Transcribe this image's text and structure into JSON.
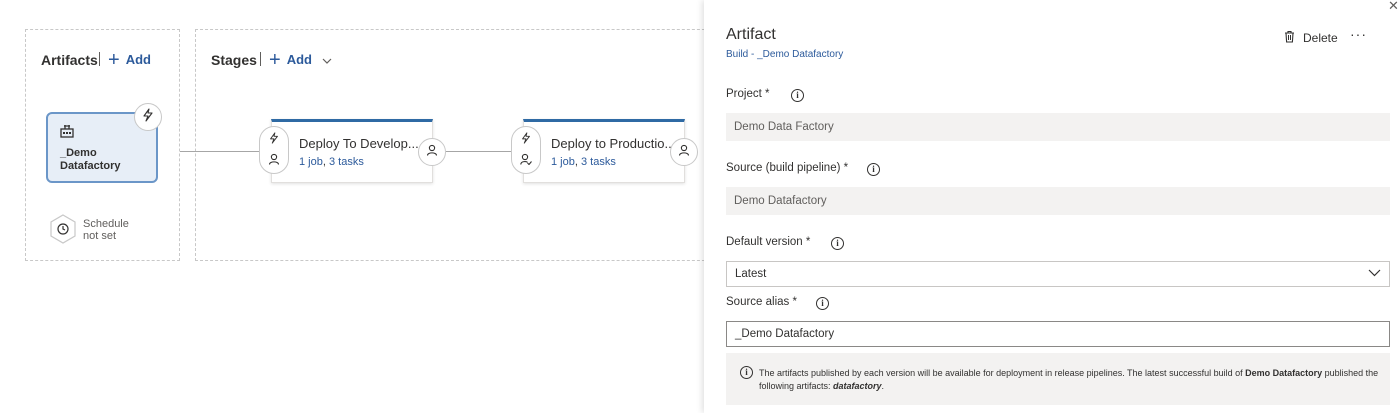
{
  "artifacts": {
    "title": "Artifacts",
    "add_label": "Add",
    "artifact_name": "_Demo Datafactory",
    "schedule_text": "Schedule not set"
  },
  "stages": {
    "title": "Stages",
    "add_label": "Add",
    "items": [
      {
        "name": "Deploy To Develop...",
        "jobs_link": "1 job",
        "separator": ", ",
        "tasks_link": "3 tasks"
      },
      {
        "name": "Deploy to Productio...",
        "jobs_link": "1 job",
        "separator": ", ",
        "tasks_link": "3 tasks"
      }
    ]
  },
  "panel": {
    "title": "Artifact",
    "subtitle": "Build - _Demo Datafactory",
    "delete_label": "Delete",
    "more_label": "···",
    "close_label": "✕",
    "project_label": "Project *",
    "project_value": "Demo Data Factory",
    "source_label": "Source (build pipeline) *",
    "source_value": "Demo Datafactory",
    "default_version_label": "Default version *",
    "default_version_value": "Latest",
    "alias_label": "Source alias *",
    "alias_value": "_Demo Datafactory",
    "info_text_1": "The artifacts published by each version will be available for deployment in release pipelines. The latest successful build of ",
    "info_bold": "Demo Datafactory",
    "info_text_2": " published the following artifacts: ",
    "info_artifact": "datafactory",
    "info_end": "."
  },
  "colors": {
    "accent": "#2c5a9b",
    "stage_top": "#2f6aa4",
    "artifact_bg": "#e7eef7",
    "artifact_border": "#6b96c8"
  },
  "icons": {
    "trigger": "lightning-icon",
    "schedule": "clock-icon",
    "approver": "person-icon",
    "artifact": "build-icon",
    "delete": "trash-icon",
    "dropdown": "chevron-down-icon",
    "info": "info-icon"
  }
}
